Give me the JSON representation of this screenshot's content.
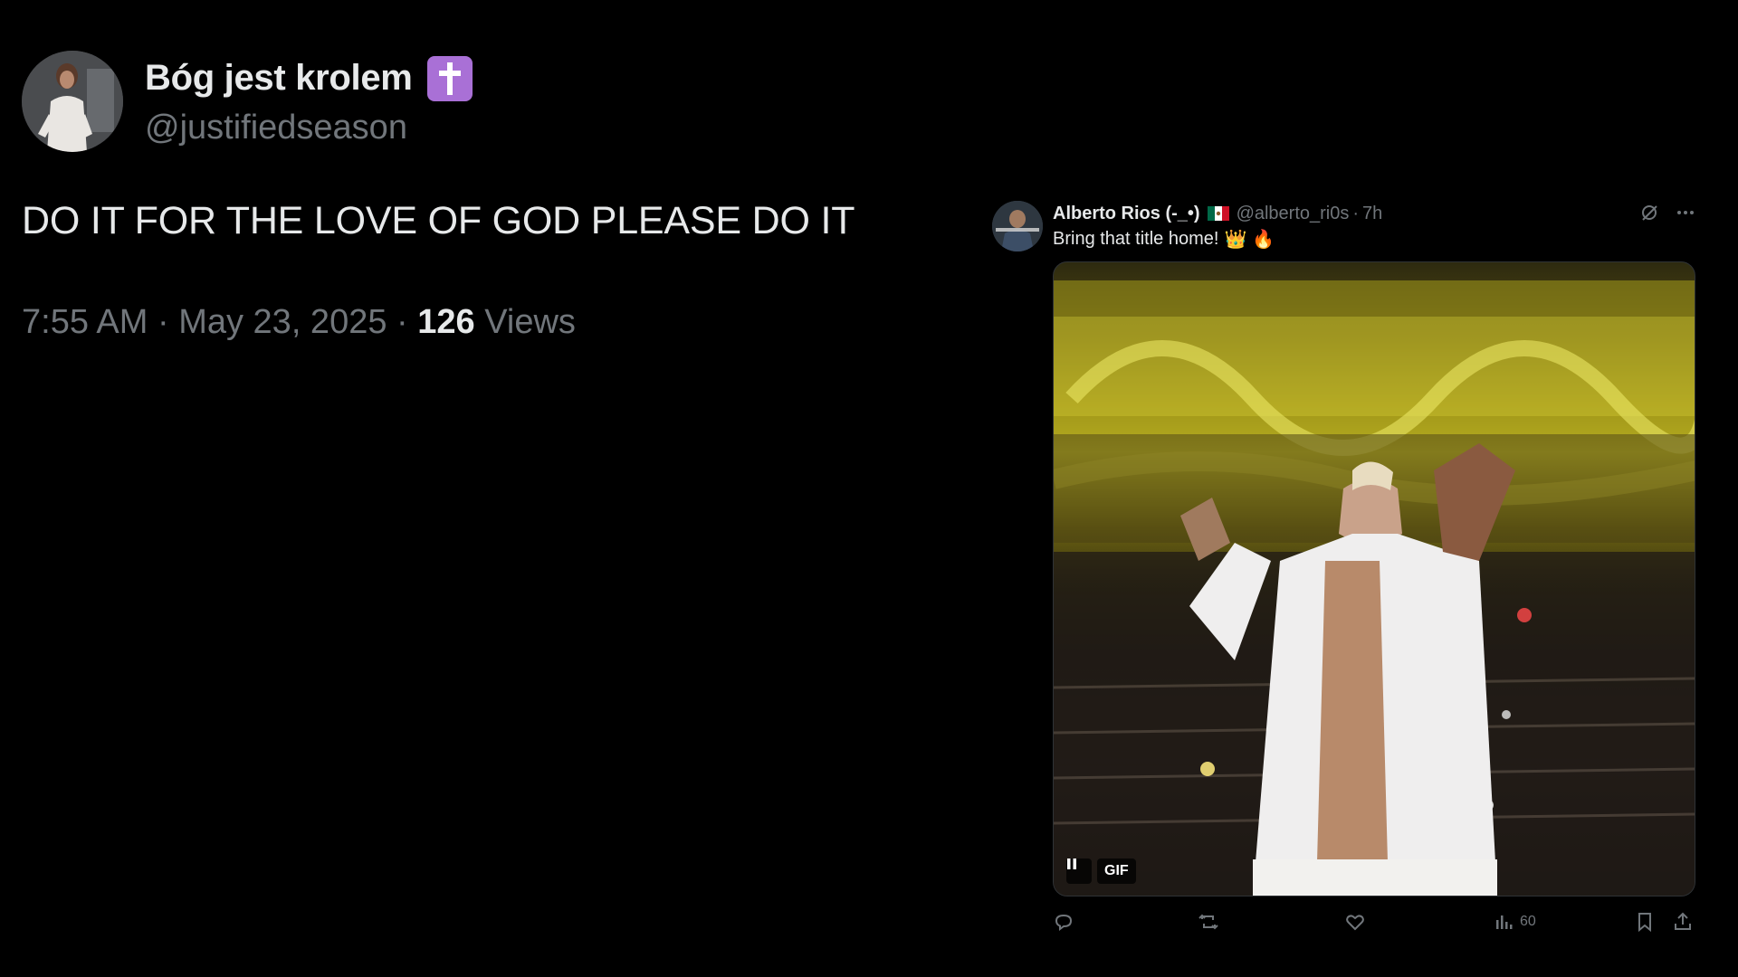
{
  "main_tweet": {
    "display_name": "Bóg jest krolem",
    "badge_emoji": "cross-icon",
    "handle": "@justifiedseason",
    "text": "DO IT FOR THE LOVE OF GOD PLEASE DO IT",
    "time": "7:55 AM",
    "date": "May 23, 2025",
    "separator": "·",
    "views_count": "126",
    "views_label": "Views"
  },
  "reply": {
    "display_name": "Alberto Rios (-_•)",
    "flag": "mexico-flag-icon",
    "handle": "@alberto_ri0s",
    "separator": "·",
    "time": "7h",
    "text": "Bring that title home!",
    "emojis": [
      "👑",
      "🔥"
    ],
    "media": {
      "type": "gif",
      "badge_label": "GIF",
      "playback": "playing"
    },
    "actions": {
      "reply_count": "",
      "repost_count": "",
      "like_count": "",
      "views_count": "60"
    }
  },
  "colors": {
    "background": "#000000",
    "primary_text": "#e7e9ea",
    "secondary_text": "#71767b",
    "badge_purple": "#a970d6"
  }
}
